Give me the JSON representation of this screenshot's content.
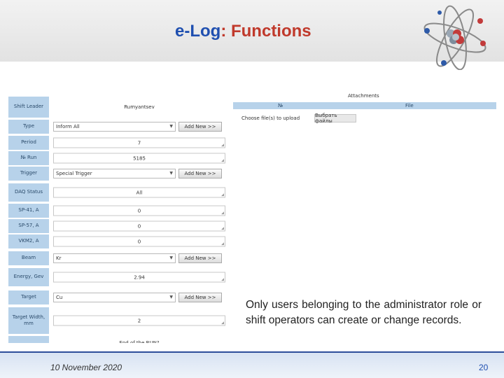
{
  "header": {
    "title_part1": "e-Log",
    "title_part2": ": Functions"
  },
  "form": {
    "shift_leader": {
      "label": "Shift Leader",
      "value": "Rumyantsev"
    },
    "type": {
      "label": "Type",
      "value": "Inform All",
      "add_label": "Add New >>"
    },
    "period": {
      "label": "Period",
      "value": "7"
    },
    "run": {
      "label": "№ Run",
      "value": "5185"
    },
    "trigger": {
      "label": "Trigger",
      "value": "Special Trigger",
      "add_label": "Add New >>"
    },
    "daq_status": {
      "label": "DAQ Status",
      "value": "All"
    },
    "sp41": {
      "label": "SP-41, A",
      "value": "0"
    },
    "sp57": {
      "label": "SP-57, A",
      "value": "0"
    },
    "vkm2": {
      "label": "VKM2, A",
      "value": "0"
    },
    "beam": {
      "label": "Beam",
      "value": "Kr",
      "add_label": "Add New >>"
    },
    "energy": {
      "label": "Energy, Gev",
      "value": "2.94"
    },
    "target": {
      "label": "Target",
      "value": "Cu",
      "add_label": "Add New >>"
    },
    "target_width": {
      "label": "Target Width, mm",
      "value": "2"
    },
    "end_of_run": {
      "label": "End of the RUN?"
    }
  },
  "attachments": {
    "title": "Attachments",
    "col_num": "№",
    "col_file": "File",
    "choose_label": "Choose file(s) to upload",
    "browse_button": "Выбрать файлы"
  },
  "note": {
    "text": "Only users belonging to the administrator role or shift operators can create or change records."
  },
  "footer": {
    "date": "10 November 2020",
    "page_number": "20"
  },
  "colors": {
    "title_blue": "#1f4fb0",
    "title_red": "#c0392b",
    "label_bg": "#b7d2ea",
    "footer_border": "#2e4e9a"
  },
  "icons": {
    "logo": "atom-icon",
    "dropdown": "chevron-down-icon",
    "resize": "resize-handle-icon"
  }
}
